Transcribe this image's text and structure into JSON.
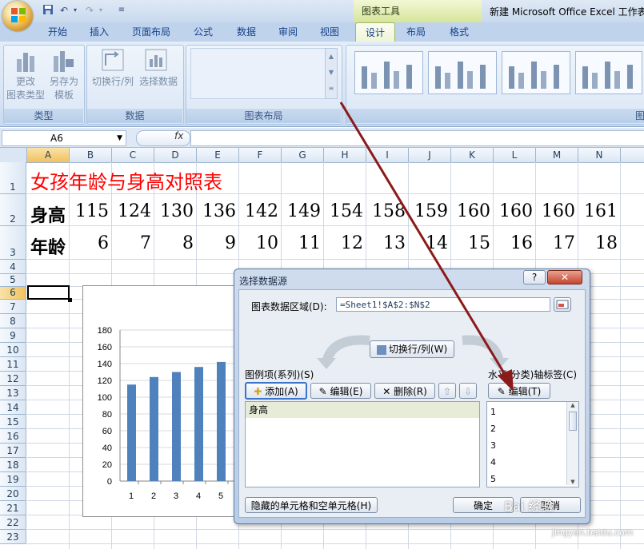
{
  "app": {
    "title": "新建 Microsoft Office Excel 工作表",
    "context_tab_group": "图表工具"
  },
  "tabs": [
    "开始",
    "插入",
    "页面布局",
    "公式",
    "数据",
    "审阅",
    "视图",
    "设计",
    "布局",
    "格式"
  ],
  "ribbon": {
    "type_group": {
      "label": "类型",
      "change_type": "更改\n图表类型",
      "save_template": "另存为\n模板"
    },
    "data_group": {
      "label": "数据",
      "switch": "切换行/列",
      "select_data": "选择数据"
    },
    "layout_group": {
      "label": "图表布局"
    },
    "style_group_label_partial": "图"
  },
  "formula_bar": {
    "name_box": "A6",
    "fx": "fx",
    "formula": ""
  },
  "sheet": {
    "columns": [
      "A",
      "B",
      "C",
      "D",
      "E",
      "F",
      "G",
      "H",
      "I",
      "J",
      "K",
      "L",
      "M",
      "N"
    ],
    "rows": [
      "1",
      "2",
      "3",
      "4",
      "5",
      "6",
      "7",
      "8",
      "9",
      "10",
      "11",
      "12",
      "13",
      "14",
      "15",
      "16",
      "17",
      "18",
      "19",
      "20",
      "21",
      "22",
      "23"
    ],
    "title": "女孩年龄与身高对照表",
    "row2_label": "身高",
    "heights": [
      "115",
      "124",
      "130",
      "136",
      "142",
      "149",
      "154",
      "158",
      "159",
      "160",
      "160",
      "160",
      "161"
    ],
    "row3_label": "年龄",
    "ages": [
      "6",
      "7",
      "8",
      "9",
      "10",
      "11",
      "12",
      "13",
      "14",
      "15",
      "16",
      "17",
      "18"
    ]
  },
  "chart_data": {
    "type": "bar",
    "categories": [
      "1",
      "2",
      "3",
      "4",
      "5"
    ],
    "values": [
      115,
      124,
      130,
      136,
      142
    ],
    "ylim": [
      0,
      180
    ],
    "yticks": [
      "0",
      "20",
      "40",
      "60",
      "80",
      "100",
      "120",
      "140",
      "160",
      "180"
    ],
    "series_color": "#4f81bd",
    "grid": true
  },
  "dialog": {
    "title": "选择数据源",
    "help": "?",
    "close": "✕",
    "range_label": "图表数据区域(D):",
    "range_value": "=Sheet1!$A$2:$N$2",
    "switch_button": "切换行/列(W)",
    "legend_label": "图例项(系列)(S)",
    "add_button": "添加(A)",
    "edit_button": "编辑(E)",
    "delete_button": "删除(R)",
    "series_items": [
      "身高"
    ],
    "axis_label": "水平(分类)轴标签(C)",
    "axis_edit_button": "编辑(T)",
    "axis_items": [
      "1",
      "2",
      "3",
      "4",
      "5"
    ],
    "hidden_cells_button": "隐藏的单元格和空单元格(H)",
    "ok_button": "确定",
    "cancel_button": "取消"
  },
  "watermark": {
    "text": "Bai 经验",
    "url": "jingyan.baidu.com"
  }
}
